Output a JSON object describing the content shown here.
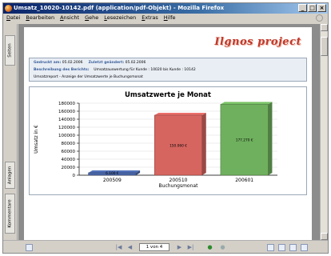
{
  "window": {
    "title": "Umsatz_10020-10142.pdf (application/pdf-Objekt) - Mozilla Firefox",
    "buttons": {
      "minimize": "_",
      "maximize": "□",
      "close": "×"
    }
  },
  "menu": [
    "Datei",
    "Bearbeiten",
    "Ansicht",
    "Gehe",
    "Lesezeichen",
    "Extras",
    "Hilfe"
  ],
  "sidebar": {
    "tabs": [
      "Seiten",
      "Anlagen",
      "Kommentare"
    ]
  },
  "report": {
    "logo": "Ilgnos project",
    "created_label": "Gedruckt am:",
    "created_value": "05.02.2006",
    "changed_label": "Zuletzt geändert:",
    "changed_value": "05.02.2006",
    "desc_label": "Beschreibung des Berichts:",
    "desc_value": "Umsatzauswertung für Kunde : 10020 bis Kunde : 10142",
    "subtitle": "Umsatzreport - Anzeige der Umsatzwerte je Buchungsmonat"
  },
  "chart_data": {
    "type": "bar",
    "title": "Umsatzwerte je Monat",
    "xlabel": "Buchungsmonat",
    "ylabel": "Umsatz in €",
    "categories": [
      "200509",
      "200510",
      "200601"
    ],
    "values": [
      6100,
      150060,
      177270
    ],
    "value_labels": [
      "6.100 €",
      "150.060 €",
      "177.270 €"
    ],
    "colors": [
      "#4a67a8",
      "#d66560",
      "#6fb05e"
    ],
    "ylim": [
      0,
      180000
    ],
    "yticks": [
      0,
      20000,
      40000,
      60000,
      80000,
      100000,
      120000,
      140000,
      160000,
      180000
    ],
    "ytick_labels": [
      "0",
      "20000",
      "40000",
      "60000",
      "80000",
      "100000",
      "120000",
      "140000",
      "160000",
      "180000"
    ],
    "grid": true
  },
  "navigation": {
    "page_display": "1 von 4"
  }
}
